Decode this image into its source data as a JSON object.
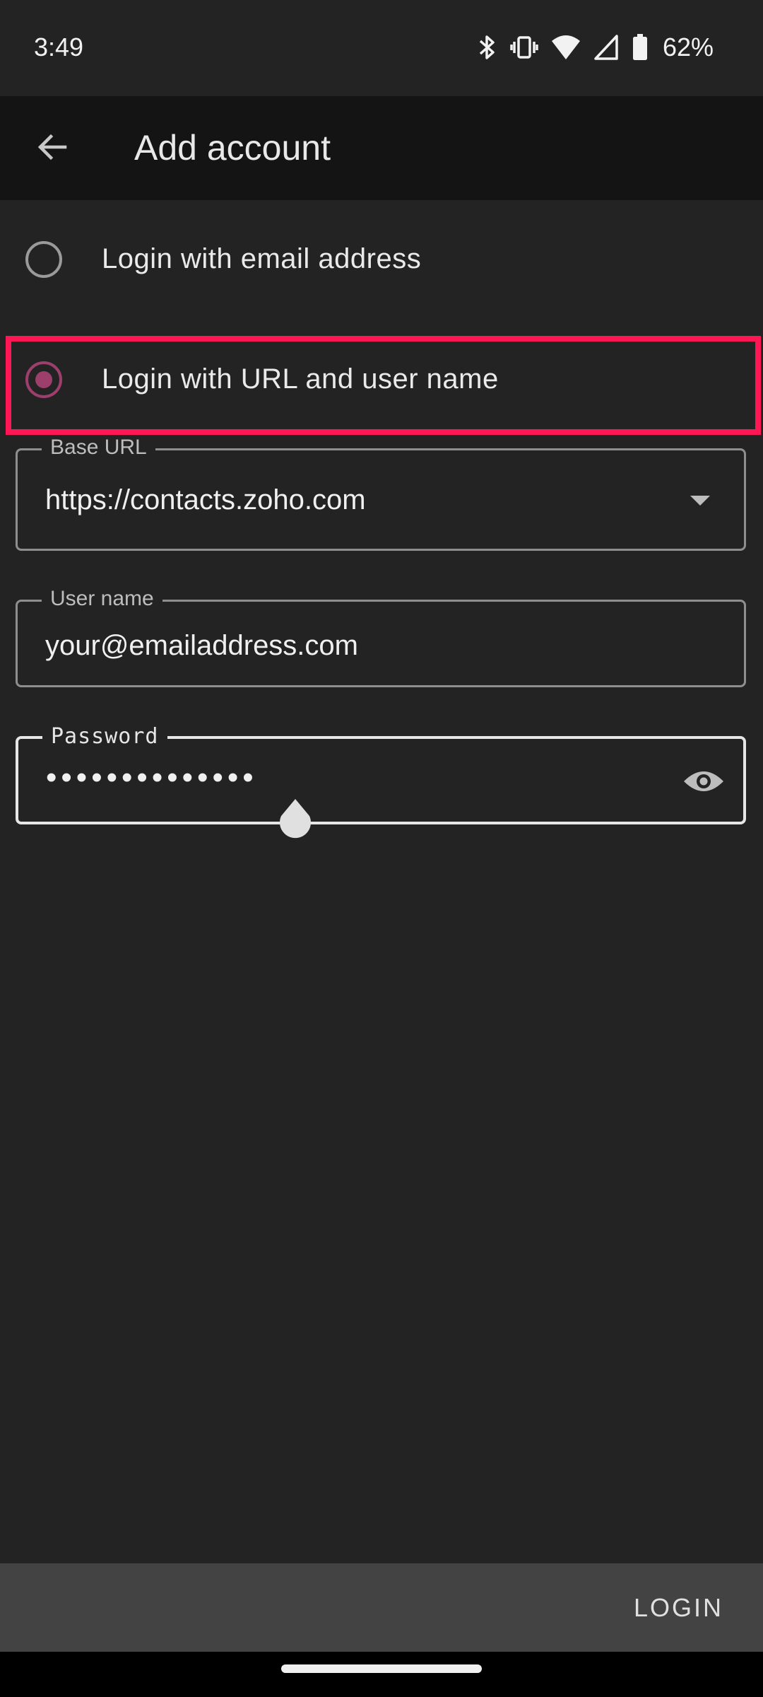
{
  "status_bar": {
    "time": "3:49",
    "battery_percent": "62%",
    "icons": [
      "bluetooth-icon",
      "vibrate-icon",
      "wifi-icon",
      "cell-signal-icon",
      "battery-icon"
    ]
  },
  "app_bar": {
    "title": "Add account",
    "back_icon": "arrow-back-icon"
  },
  "login_options": {
    "email_label": "Login with email address",
    "email_selected": false,
    "url_label": "Login with URL and user name",
    "url_selected": true
  },
  "form": {
    "base_url": {
      "label": "Base URL",
      "value": "https://contacts.zoho.com"
    },
    "user_name": {
      "label": "User name",
      "value": "your@emailaddress.com"
    },
    "password": {
      "label": "Password",
      "value": "••••••••••••••"
    }
  },
  "footer": {
    "login_label": "LOGIN"
  },
  "colors": {
    "background": "#232323",
    "app_bar": "#141414",
    "accent_radio": "#9c3f6c",
    "highlight": "#ff1654",
    "footer_bar": "#434343"
  }
}
